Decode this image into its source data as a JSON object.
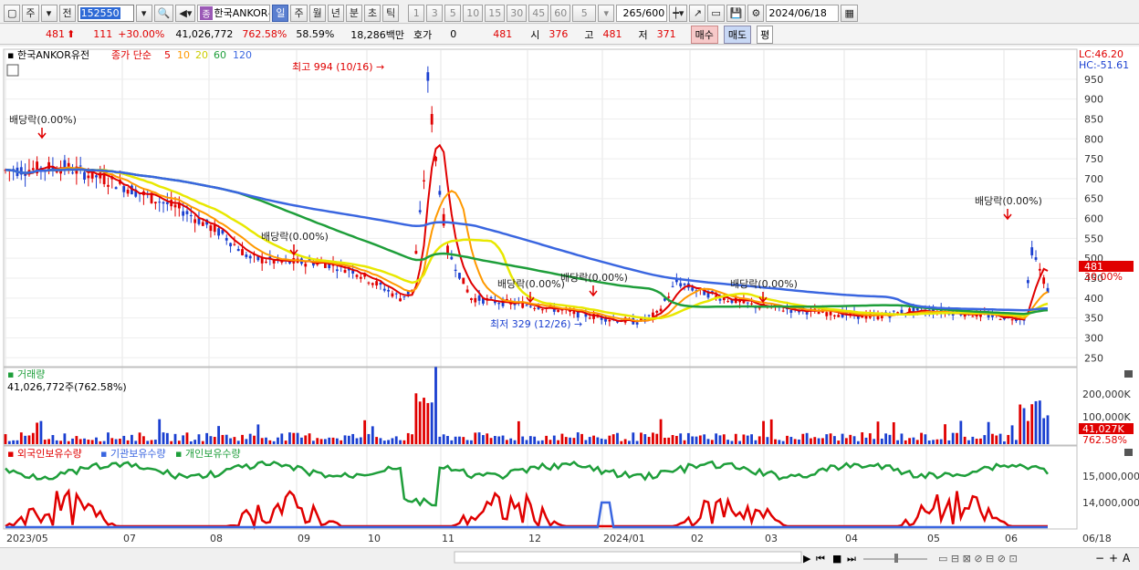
{
  "toolbar": {
    "period_label": "주",
    "prev_label": "전",
    "stock_code": "152550",
    "stock_name": "한국ANKOR유",
    "jung_badge": "종",
    "period_buttons": [
      "일",
      "주",
      "월",
      "년",
      "분",
      "초",
      "틱"
    ],
    "interval_buttons": [
      "1",
      "3",
      "5",
      "10",
      "15",
      "30",
      "45",
      "60"
    ],
    "interval_value": "5",
    "count": "265/600",
    "date": "2024/06/18"
  },
  "quote": {
    "price": "481",
    "change": "111",
    "change_pct": "+30.00%",
    "volume": "41,026,772",
    "volume_ratio": "762.58%",
    "rate": "58.59%",
    "amount": "18,286백만",
    "hoga_label": "호가",
    "hoga_value": "0",
    "current": "481",
    "open_label": "시",
    "open": "376",
    "high_label": "고",
    "high": "481",
    "low_label": "저",
    "low": "371",
    "buy_label": "매수",
    "sell_label": "매도",
    "avg_label": "평"
  },
  "price_panel": {
    "legend_name": "한국ANKOR유전",
    "legend_ma": "종가 단순",
    "ma_periods": [
      "5",
      "10",
      "20",
      "60",
      "120"
    ],
    "ma_colors": [
      "#e00000",
      "#ff9900",
      "#e8e800",
      "#1e9e3a",
      "#3a66e0"
    ],
    "lc_label": "LC:46.20",
    "hc_label": "HC:-51.61",
    "y_ticks": [
      "950",
      "900",
      "850",
      "800",
      "750",
      "700",
      "650",
      "600",
      "550",
      "500",
      "450",
      "400",
      "350",
      "300",
      "250"
    ],
    "current_price_tag": "481",
    "current_pct_tag": "30.00%",
    "high_annotation": "최고 994 (10/16)",
    "low_annotation": "최저 329 (12/26)",
    "dividend_label": "배당락(0.00%)"
  },
  "volume_panel": {
    "title": "거래량",
    "subtitle": "41,026,772주(762.58%)",
    "y_ticks": [
      "200,000K",
      "100,000K"
    ],
    "current_tag": "41,027K",
    "current_pct_tag": "762.58%"
  },
  "holdings_panel": {
    "legend": [
      "외국인보유수량",
      "기관보유수량",
      "개인보유수량"
    ],
    "colors": [
      "#e00000",
      "#3a66e0",
      "#1e9e3a"
    ],
    "y_ticks": [
      "15,000,000",
      "14,000,000"
    ]
  },
  "x_axis": {
    "labels": [
      "2023/05",
      "07",
      "08",
      "09",
      "10",
      "11",
      "12",
      "2024/01",
      "02",
      "03",
      "04",
      "05",
      "06",
      "06/18"
    ]
  },
  "chart_data": {
    "type": "candlestick",
    "ma_series": [
      "5",
      "10",
      "20",
      "60",
      "120"
    ],
    "y_range": [
      230,
      1000
    ],
    "annotations": {
      "high": {
        "value": 994,
        "date": "10/16"
      },
      "low": {
        "value": 329,
        "date": "12/26"
      }
    },
    "last_price": 481,
    "last_volume_k": 41027
  }
}
